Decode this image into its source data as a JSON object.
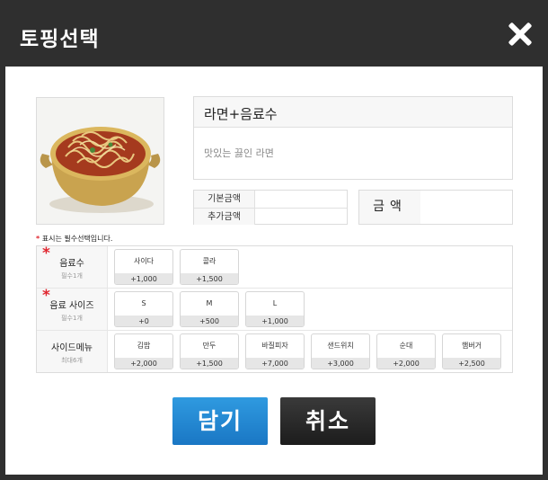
{
  "header": {
    "title": "토핑선택"
  },
  "product": {
    "name": "라면+음료수",
    "description": "맛있는 끓인 라면"
  },
  "price": {
    "base_label": "기본금액",
    "base_value": "",
    "extra_label": "추가금액",
    "extra_value": "",
    "total_label": "금액",
    "total_value": ""
  },
  "required_note": {
    "star": "*",
    "text": "표시는 필수선택입니다."
  },
  "options": {
    "drink": {
      "name": "음료수",
      "sub": "필수1개",
      "required": true,
      "items": [
        {
          "name": "사이다",
          "price": "+1,000"
        },
        {
          "name": "콜라",
          "price": "+1,500"
        }
      ]
    },
    "size": {
      "name": "음료 사이즈",
      "sub": "필수1개",
      "required": true,
      "items": [
        {
          "name": "S",
          "price": "+0"
        },
        {
          "name": "M",
          "price": "+500"
        },
        {
          "name": "L",
          "price": "+1,000"
        }
      ]
    },
    "side": {
      "name": "사이드메뉴",
      "sub": "최대6개",
      "required": false,
      "items": [
        {
          "name": "김밥",
          "price": "+2,000"
        },
        {
          "name": "만두",
          "price": "+1,500"
        },
        {
          "name": "바질피자",
          "price": "+7,000"
        },
        {
          "name": "샌드위치",
          "price": "+3,000"
        },
        {
          "name": "순대",
          "price": "+2,000"
        },
        {
          "name": "햄버거",
          "price": "+2,500"
        }
      ]
    }
  },
  "buttons": {
    "ok": "담기",
    "cancel": "취소"
  },
  "colors": {
    "header_bg": "#2f2f2f",
    "ok_button": "#1f86d1",
    "cancel_button": "#262626",
    "required_star": "#e0262f"
  }
}
